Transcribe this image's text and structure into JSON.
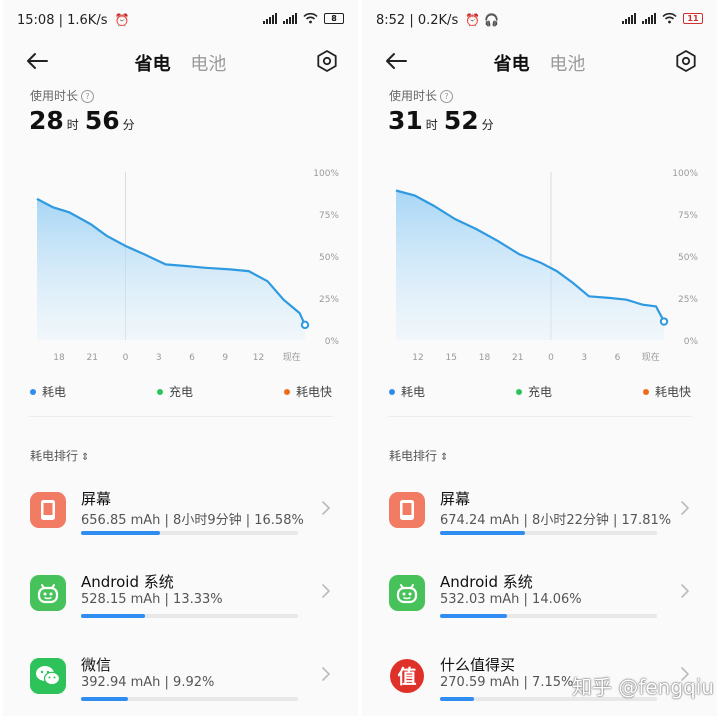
{
  "colors": {
    "accent": "#2f8cf0",
    "line": "#2f9ae0",
    "legend_consume": "#2f8cf0",
    "legend_charge": "#2dc35a",
    "legend_fast": "#f06a1e",
    "screen_icon_bg": "#f27c63",
    "android_icon_bg": "#47c25a",
    "wechat_icon_bg": "#2dc35a",
    "smzdm_icon_bg": "#e0302a"
  },
  "panels": [
    {
      "status": {
        "time": "15:08",
        "speed": "1.6K/s",
        "battery": "8"
      },
      "tabs": {
        "active": "省电",
        "inactive": "电池"
      },
      "usage": {
        "label": "使用时长",
        "hours": "28",
        "hours_unit": "时",
        "minutes": "56",
        "minutes_unit": "分"
      },
      "chart_data": {
        "type": "area",
        "y_ticks": [
          "100%",
          "75%",
          "50%",
          "25%",
          "0%"
        ],
        "x_ticks": [
          "18",
          "21",
          "0",
          "3",
          "6",
          "9",
          "12",
          "现在"
        ],
        "ylim": [
          0,
          100
        ],
        "x": [
          0,
          0.06,
          0.12,
          0.2,
          0.26,
          0.33,
          0.4,
          0.48,
          0.56,
          0.63,
          0.72,
          0.79,
          0.86,
          0.92,
          0.98,
          1
        ],
        "values": [
          84,
          79,
          76,
          69,
          62,
          56,
          51,
          45,
          44,
          43,
          42,
          41,
          35,
          24,
          16,
          9
        ]
      },
      "legend": {
        "consume": "耗电",
        "charge": "充电",
        "fast": "耗电快"
      },
      "rank_label": "耗电排行",
      "apps": [
        {
          "name": "屏幕",
          "detail": "656.85 mAh | 8小时9分钟 | 16.58%",
          "percent": 16.58,
          "icon": "screen-icon"
        },
        {
          "name": "Android 系统",
          "detail": "528.15 mAh | 13.33%",
          "percent": 13.33,
          "icon": "android-icon"
        },
        {
          "name": "微信",
          "detail": "392.94 mAh | 9.92%",
          "percent": 9.92,
          "icon": "wechat-icon"
        }
      ]
    },
    {
      "status": {
        "time": "8:52",
        "speed": "0.2K/s",
        "battery": "11"
      },
      "tabs": {
        "active": "省电",
        "inactive": "电池"
      },
      "usage": {
        "label": "使用时长",
        "hours": "31",
        "hours_unit": "时",
        "minutes": "52",
        "minutes_unit": "分"
      },
      "chart_data": {
        "type": "area",
        "y_ticks": [
          "100%",
          "75%",
          "50%",
          "25%",
          "0%"
        ],
        "x_ticks": [
          "12",
          "15",
          "18",
          "21",
          "0",
          "3",
          "6",
          "现在"
        ],
        "ylim": [
          0,
          100
        ],
        "x": [
          0,
          0.07,
          0.14,
          0.22,
          0.3,
          0.38,
          0.46,
          0.54,
          0.6,
          0.66,
          0.72,
          0.8,
          0.86,
          0.92,
          0.97,
          1
        ],
        "values": [
          89,
          86,
          80,
          72,
          66,
          59,
          51,
          46,
          41,
          34,
          26,
          25,
          24,
          21,
          20,
          11
        ]
      },
      "legend": {
        "consume": "耗电",
        "charge": "充电",
        "fast": "耗电快"
      },
      "rank_label": "耗电排行",
      "apps": [
        {
          "name": "屏幕",
          "detail": "674.24 mAh | 8小时22分钟 | 17.81%",
          "percent": 17.81,
          "icon": "screen-icon"
        },
        {
          "name": "Android 系统",
          "detail": "532.03 mAh | 14.06%",
          "percent": 14.06,
          "icon": "android-icon"
        },
        {
          "name": "什么值得买",
          "detail": "270.59 mAh | 7.15%",
          "percent": 7.15,
          "icon": "smzdm-icon"
        }
      ]
    }
  ],
  "watermark": "知乎 @fengqiu"
}
